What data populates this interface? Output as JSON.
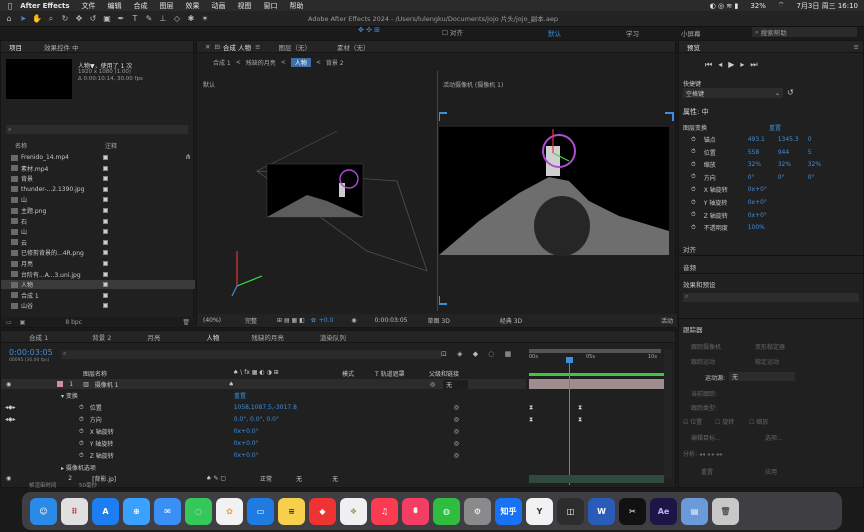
{
  "menubar": {
    "app": "After Effects",
    "items": [
      "文件",
      "编辑",
      "合成",
      "图层",
      "效果",
      "动画",
      "视图",
      "窗口",
      "帮助"
    ],
    "battery": "32%",
    "clock": "7月3日 周三  16:10"
  },
  "titlebar": {
    "title": "Adobe After Effects 2024 - /Users/lulengku/Documents/jojo 片头/jojo_副本.aep",
    "snap": "对齐",
    "workspaces": [
      "默认",
      "学习",
      "小屏幕"
    ],
    "search_placeholder": "搜索帮助"
  },
  "project": {
    "tab": "项目",
    "tab2": "效果控件 中",
    "selected_name": "人物▼，使用了 1 次",
    "selected_info1": "1920 x 1080 (1.00)",
    "selected_info2": "Δ 0:00:10:14, 30.00 fps",
    "search_placeholder": "",
    "col_name": "名称",
    "col_note": "注释",
    "items": [
      "Frenido_14.mp4",
      "素材.mp4",
      "背景",
      "thunder-...2.1390.jpg",
      "山",
      "主题.png",
      "石",
      "山",
      "云",
      "已修剪背景的...4R.png",
      "月亮",
      "台阶有...A...3.uni.jpg",
      "人物",
      "合成 1",
      "山谷"
    ],
    "footer": "8 bpc"
  },
  "composition": {
    "tab_comp": "合成 人物",
    "tab_layer": "图层（无）",
    "tab_footage": "素材（无）",
    "crumbs": [
      "合成 1",
      "残缺的月亮",
      "人物",
      "背景 2"
    ],
    "left_view_label": "默认",
    "right_view_label": "活动摄像机 (摄像机 1)",
    "zoom": "(40%)",
    "quality": "完整",
    "exposure": "+0.0",
    "timecode": "0:00:03:05",
    "view_mode": "草图 3D",
    "renderer": "经典 3D",
    "active": "活动"
  },
  "right_panel": {
    "preview": "预览",
    "shortcut_label": "快捷键",
    "shortcut_value": "空格键",
    "props_title": "属性: 中",
    "layer_transform": "图层变换",
    "reset": "重置",
    "props": [
      {
        "label": "锚点",
        "v1": "493.1",
        "v2": "1345.3",
        "v3": "0"
      },
      {
        "label": "位置",
        "v1": "558",
        "v2": "944",
        "v3": "5"
      },
      {
        "label": "缩放",
        "v1": "32%",
        "v2": "32%",
        "v3": "32%"
      },
      {
        "label": "方向",
        "v1": "0°",
        "v2": "0°",
        "v3": "0°"
      },
      {
        "label": "X 轴旋转",
        "v1": "0x+0°",
        "v2": "",
        "v3": ""
      },
      {
        "label": "Y 轴旋转",
        "v1": "0x+0°",
        "v2": "",
        "v3": ""
      },
      {
        "label": "Z 轴旋转",
        "v1": "0x+0°",
        "v2": "",
        "v3": ""
      },
      {
        "label": "不透明度",
        "v1": "100%",
        "v2": "",
        "v3": ""
      }
    ],
    "align": "对齐",
    "audio": "音频",
    "effects": "效果和预设",
    "tracker": "跟踪器",
    "tracker_items": [
      "跟踪摄像机",
      "变形稳定器",
      "跟踪运动",
      "稳定运动"
    ],
    "motion_source_label": "运动源:",
    "motion_source_value": "无",
    "current_track": "当前跟踪:",
    "track_type": "跟踪类型:",
    "position": "位置",
    "rotation": "旋转",
    "scale": "缩放",
    "edit_target": "编辑目标...",
    "options": "选项...",
    "analyze": "分析:",
    "reset_btn": "重置",
    "apply_btn": "应用"
  },
  "timeline": {
    "tabs": [
      "合成 1",
      "背景 2",
      "月亮",
      "人物",
      "残缺的月亮",
      "渲染队列"
    ],
    "timecode": "0:00:03:05",
    "fps_sub": "00095 (30.00 fps)",
    "col_source": "图层名称",
    "col_mode": "模式",
    "col_track": "T  轨道遮罩",
    "col_parent": "父级和链接",
    "layer1_num": "1",
    "layer1_name": "摄像机 1",
    "parent_value": "无",
    "transform": "变换",
    "reset": "重置",
    "rows": [
      {
        "label": "位置",
        "value": "1058,1087.5,-3017.8"
      },
      {
        "label": "方向",
        "value": "0.0°, 0.0°, 0.0°"
      },
      {
        "label": "X 轴旋转",
        "value": "0x+0.0°"
      },
      {
        "label": "Y 轴旋转",
        "value": "0x+0.0°"
      },
      {
        "label": "Z 轴旋转",
        "value": "0x+0.0°"
      }
    ],
    "camera_options": "摄像机选项",
    "layer2_num": "2",
    "layer2_name": "[背影.jp]",
    "layer2_mode": "正常",
    "layer2_track": "无",
    "layer2_parent": "无",
    "footer_left": "帧渲染时间",
    "footer_right": "50毫秒",
    "ruler": [
      "00s",
      "05s",
      "10s"
    ]
  },
  "dock_apps": [
    "Finder",
    "Launchpad",
    "App Store",
    "Safari",
    "Mail",
    "Messages",
    "Photos",
    "Keynote",
    "Notes",
    "Creative",
    "Office",
    "Music",
    "Podcasts",
    "WeChat",
    "Settings",
    "知乎",
    "Y",
    "Editor",
    "Word",
    "CapCut",
    "Ae",
    "Files",
    "Trash"
  ]
}
